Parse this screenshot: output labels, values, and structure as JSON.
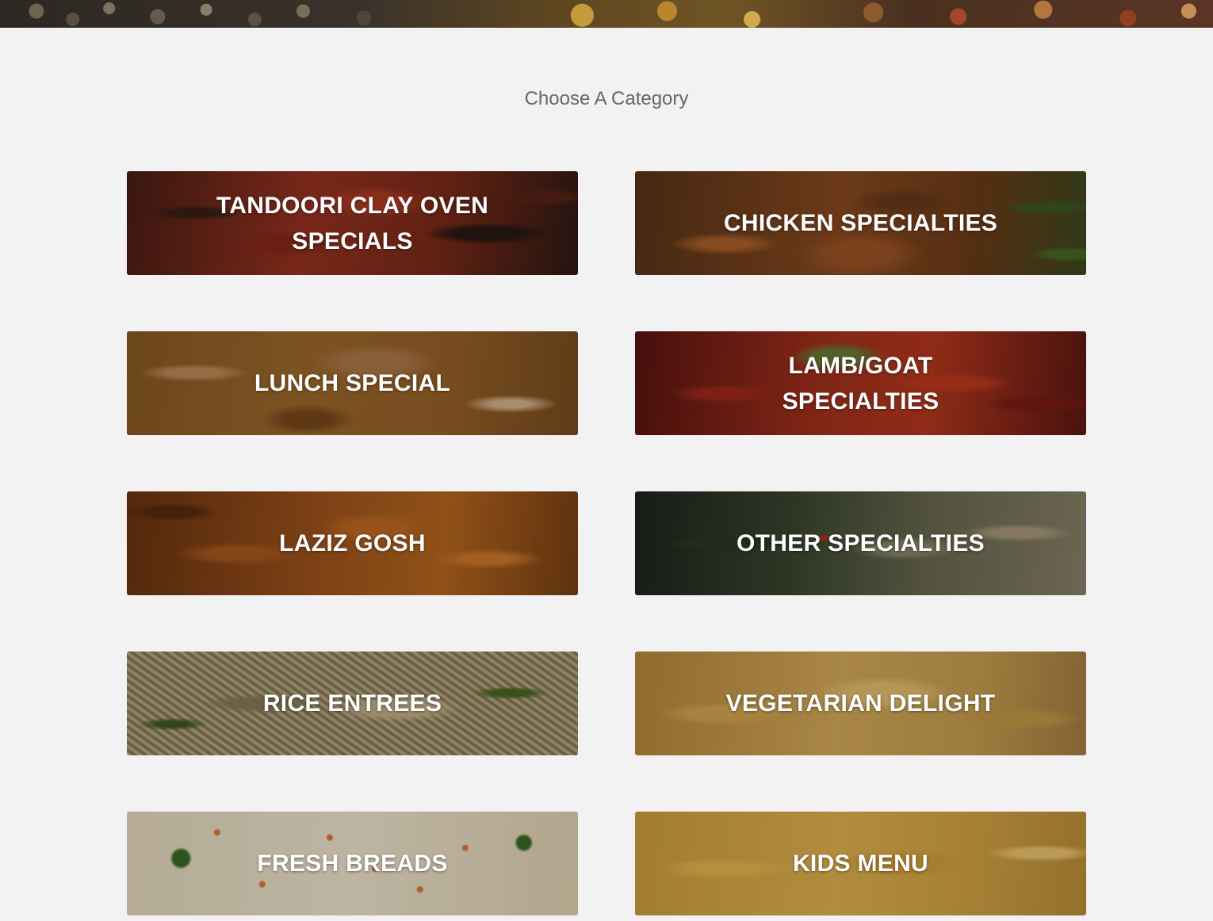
{
  "page": {
    "heading": "Choose A Category"
  },
  "categories": [
    {
      "label": "TANDOORI CLAY OVEN SPECIALS",
      "texture": "tandoori-icon"
    },
    {
      "label": "CHICKEN SPECIALTIES",
      "texture": "chicken-icon"
    },
    {
      "label": "LUNCH SPECIAL",
      "texture": "lunch-icon"
    },
    {
      "label": "LAMB/GOAT SPECIALTIES",
      "texture": "lamb-icon"
    },
    {
      "label": "LAZIZ GOSH",
      "texture": "laziz-icon"
    },
    {
      "label": "OTHER SPECIALTIES",
      "texture": "other-icon"
    },
    {
      "label": "RICE ENTREES",
      "texture": "rice-icon"
    },
    {
      "label": "VEGETARIAN DELIGHT",
      "texture": "veg-icon"
    },
    {
      "label": "FRESH BREADS",
      "texture": "bread-icon"
    },
    {
      "label": "KIDS MENU",
      "texture": "kids-icon"
    }
  ],
  "colors": {
    "background": "#f2f2f2",
    "heading": "#666666",
    "tile_text": "#ffffff"
  }
}
